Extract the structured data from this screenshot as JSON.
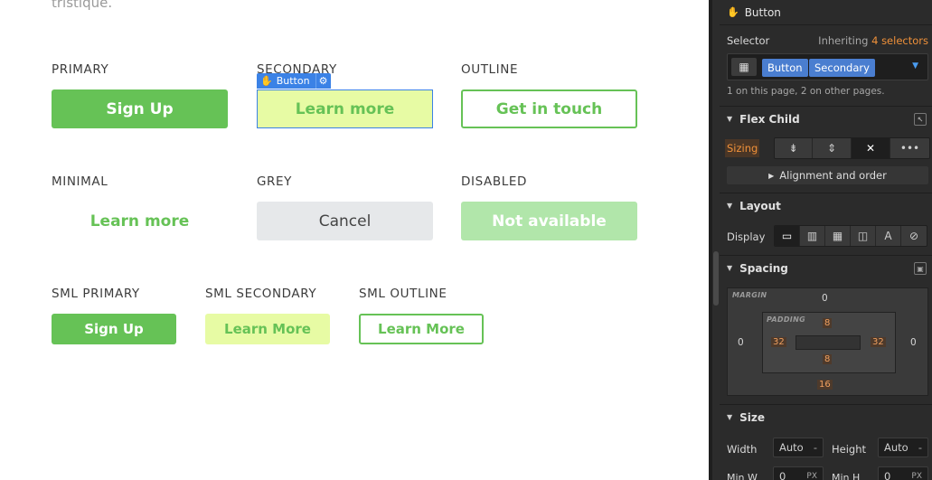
{
  "canvas": {
    "intro_text": "tristique.",
    "sections": {
      "primary": {
        "label": "PRIMARY",
        "button": "Sign Up"
      },
      "secondary": {
        "label": "SECONDARY",
        "button": "Learn more"
      },
      "outline": {
        "label": "OUTLINE",
        "button": "Get in touch"
      },
      "minimal": {
        "label": "MINIMAL",
        "button": "Learn more"
      },
      "grey": {
        "label": "GREY",
        "button": "Cancel"
      },
      "disabled": {
        "label": "DISABLED",
        "button": "Not available"
      },
      "sml_primary": {
        "label": "SML PRIMARY",
        "button": "Sign Up"
      },
      "sml_secondary": {
        "label": "SML SECONDARY",
        "button": "Learn More"
      },
      "sml_outline": {
        "label": "SML OUTLINE",
        "button": "Learn More"
      }
    },
    "selection_tag": "Button",
    "colors": {
      "green": "#66c256",
      "secondary_bg": "#e7fba4",
      "selection": "#3b82e6"
    }
  },
  "panel": {
    "header_title": "Button",
    "selector": {
      "label": "Selector",
      "inheriting_prefix": "Inheriting",
      "inheriting_link": "4 selectors",
      "chips": [
        "Button",
        "Secondary"
      ],
      "usage": "1 on this page, 2 on other pages."
    },
    "flex_child": {
      "title": "Flex Child",
      "sizing_label": "Sizing",
      "alignment_label": "Alignment and order"
    },
    "layout": {
      "title": "Layout",
      "display_label": "Display"
    },
    "spacing": {
      "title": "Spacing",
      "margin_label": "MARGIN",
      "padding_label": "PADDING",
      "margin": {
        "top": "0",
        "right": "0",
        "bottom": "16",
        "left": "0"
      },
      "padding": {
        "top": "8",
        "right": "32",
        "bottom": "8",
        "left": "32"
      }
    },
    "size": {
      "title": "Size",
      "width_label": "Width",
      "width_value": "Auto",
      "height_label": "Height",
      "height_value": "Auto",
      "min_w_label": "Min W",
      "min_w_value": "0",
      "min_h_label": "Min H",
      "min_h_value": "0",
      "unit": "PX",
      "dash": "-"
    },
    "colors": {
      "accent": "#f0913a",
      "chip": "#4a7ed0"
    }
  }
}
